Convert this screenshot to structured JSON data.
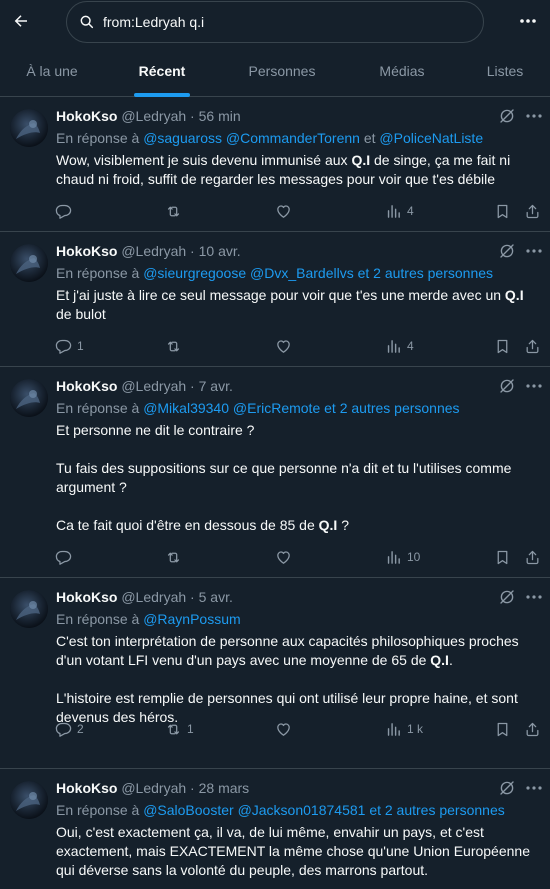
{
  "search": {
    "value": "from:Ledryah q.i"
  },
  "tabs": [
    {
      "label": "À la une"
    },
    {
      "label": "Récent"
    },
    {
      "label": "Personnes"
    },
    {
      "label": "Médias"
    },
    {
      "label": "Listes"
    }
  ],
  "colors": {
    "background": "#15202b",
    "accent": "#1d9bf0",
    "muted": "#8b98a5",
    "border": "#38444d"
  },
  "tweets": [
    {
      "name": "HokoKso",
      "handle": "@Ledryah",
      "dot": "·",
      "time": "56 min",
      "reply_prefix": "En réponse à",
      "reply_links": [
        "@saguaross",
        "@CommanderTorenn",
        "et",
        "@PoliceNatListe"
      ],
      "paras": [
        {
          "t1": "Wow, visiblement je suis devenu immunisé aux ",
          "b1": "Q.I",
          "t2": " de singe, ça me fait ni chaud ni froid, suffit de regarder les messages pour voir que t'es débile"
        }
      ],
      "counts": {
        "reply": "",
        "retweet": "",
        "views": "4"
      }
    },
    {
      "name": "HokoKso",
      "handle": "@Ledryah",
      "dot": "·",
      "time": "10 avr.",
      "reply_prefix": "En réponse à",
      "reply_links": [
        "@sieurgregoose",
        "@Dvx_Bardellvs",
        "et 2 autres personnes"
      ],
      "paras": [
        {
          "t1": "Et j'ai juste à lire ce seul message pour voir que t'es une merde avec un ",
          "b1": "Q.I",
          "t2": " de bulot"
        }
      ],
      "counts": {
        "reply": "1",
        "retweet": "",
        "views": "4"
      }
    },
    {
      "name": "HokoKso",
      "handle": "@Ledryah",
      "dot": "·",
      "time": "7 avr.",
      "reply_prefix": "En réponse à",
      "reply_links": [
        "@Mikal39340",
        "@EricRemote",
        "et 2 autres personnes"
      ],
      "paras": [
        {
          "t1": "Et personne ne dit le contraire ?"
        },
        {
          "t1": "Tu fais des suppositions sur ce que personne n'a dit et tu l'utilises comme argument ?"
        },
        {
          "t1": "Ca te fait quoi d'être en dessous de 85 de ",
          "b1": "Q.I",
          "t2": " ?"
        }
      ],
      "counts": {
        "reply": "",
        "retweet": "",
        "views": "10"
      }
    },
    {
      "name": "HokoKso",
      "handle": "@Ledryah",
      "dot": "·",
      "time": "5 avr.",
      "reply_prefix": "En réponse à",
      "reply_links": [
        "@RaynPossum"
      ],
      "paras": [
        {
          "t1": "C'est ton interprétation de personne aux capacités philosophiques proches d'un votant LFI venu d'un pays avec une moyenne de 65 de ",
          "b1": "Q.I",
          "t2": "."
        },
        {
          "t1": "L'histoire est remplie de personnes qui ont utilisé leur propre haine, et sont devenus des héros."
        }
      ],
      "counts": {
        "reply": "2",
        "retweet": "1",
        "views": "1 k"
      }
    },
    {
      "name": "HokoKso",
      "handle": "@Ledryah",
      "dot": "·",
      "time": "28 mars",
      "reply_prefix": "En réponse à",
      "reply_links": [
        "@SaloBooster",
        "@Jackson01874581",
        "et 2 autres personnes"
      ],
      "paras": [
        {
          "t1": "Oui, c'est exactement ça, il va, de lui même, envahir un pays, et c'est exactement, mais EXACTEMENT la même chose qu'une Union Européenne qui déverse sans la volonté du peuple, des marrons partout."
        }
      ],
      "counts": {
        "reply": "",
        "retweet": "",
        "views": ""
      }
    }
  ]
}
